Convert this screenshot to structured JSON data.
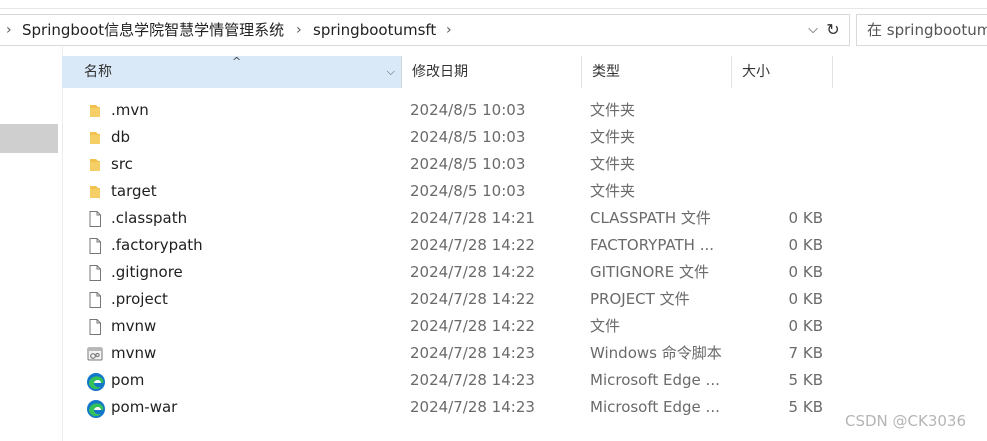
{
  "breadcrumb": {
    "items": [
      "Springboot信息学院智慧学情管理系统",
      "springbootumsft"
    ]
  },
  "search": {
    "placeholder": "在 springbootumsft 中搜索"
  },
  "columns": {
    "name": "名称",
    "date": "修改日期",
    "type": "类型",
    "size": "大小"
  },
  "files": [
    {
      "name": ".mvn",
      "date": "2024/8/5 10:03",
      "type": "文件夹",
      "size": "",
      "icon": "folder-icon"
    },
    {
      "name": "db",
      "date": "2024/8/5 10:03",
      "type": "文件夹",
      "size": "",
      "icon": "folder-icon"
    },
    {
      "name": "src",
      "date": "2024/8/5 10:03",
      "type": "文件夹",
      "size": "",
      "icon": "folder-icon"
    },
    {
      "name": "target",
      "date": "2024/8/5 10:03",
      "type": "文件夹",
      "size": "",
      "icon": "folder-icon"
    },
    {
      "name": ".classpath",
      "date": "2024/7/28 14:21",
      "type": "CLASSPATH 文件",
      "size": "0 KB",
      "icon": "file-icon"
    },
    {
      "name": ".factorypath",
      "date": "2024/7/28 14:22",
      "type": "FACTORYPATH ...",
      "size": "0 KB",
      "icon": "file-icon"
    },
    {
      "name": ".gitignore",
      "date": "2024/7/28 14:22",
      "type": "GITIGNORE 文件",
      "size": "0 KB",
      "icon": "file-icon"
    },
    {
      "name": ".project",
      "date": "2024/7/28 14:22",
      "type": "PROJECT 文件",
      "size": "0 KB",
      "icon": "file-icon"
    },
    {
      "name": "mvnw",
      "date": "2024/7/28 14:22",
      "type": "文件",
      "size": "0 KB",
      "icon": "file-icon"
    },
    {
      "name": "mvnw",
      "date": "2024/7/28 14:23",
      "type": "Windows 命令脚本",
      "size": "7 KB",
      "icon": "script-icon"
    },
    {
      "name": "pom",
      "date": "2024/7/28 14:23",
      "type": "Microsoft Edge ...",
      "size": "5 KB",
      "icon": "edge-icon"
    },
    {
      "name": "pom-war",
      "date": "2024/7/28 14:23",
      "type": "Microsoft Edge ...",
      "size": "5 KB",
      "icon": "edge-icon"
    }
  ],
  "watermark": "CSDN @CK3036",
  "colors": {
    "header_selected": "#d9e9f7",
    "folder": "#f2c14e",
    "edge_blue": "#1277c9",
    "edge_green": "#35c15a"
  }
}
